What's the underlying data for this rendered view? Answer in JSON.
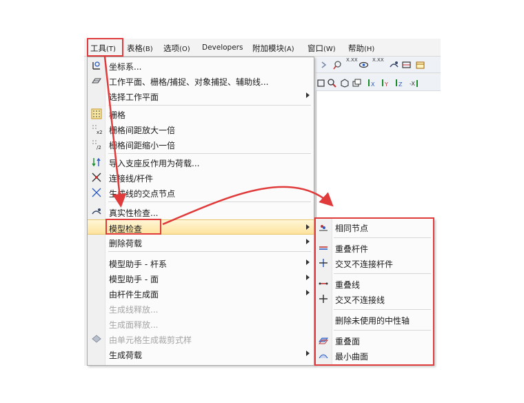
{
  "menubar": {
    "items": [
      {
        "label": "工具",
        "accel": "(T)"
      },
      {
        "label": "表格",
        "accel": "(B)"
      },
      {
        "label": "选项",
        "accel": "(O)"
      },
      {
        "label": "Developers",
        "accel": ""
      },
      {
        "label": "附加模块",
        "accel": "(A)"
      },
      {
        "label": "窗口",
        "accel": "(W)"
      },
      {
        "label": "帮助",
        "accel": "(H)"
      }
    ]
  },
  "toolbar": {
    "xxx_label": "X.XX"
  },
  "tools_menu": {
    "items": [
      {
        "label": "坐标系...",
        "icon": "coordinate-system-icon"
      },
      {
        "label": "工作平面、栅格/捕捉、对象捕捉、辅助线...",
        "icon": "work-plane-icon"
      },
      {
        "label": "选择工作平面",
        "icon": "",
        "submenu": true
      },
      {
        "label": "栅格",
        "icon": "grid-icon"
      },
      {
        "label": "栅格间距放大一倍",
        "icon": "grid-double-icon"
      },
      {
        "label": "栅格间距缩小一倍",
        "icon": "grid-half-icon"
      },
      {
        "label": "导入支座反作用为荷载...",
        "icon": "import-reactions-icon"
      },
      {
        "label": "连接线/杆件",
        "icon": "connect-lines-icon"
      },
      {
        "label": "生成线的交点节点",
        "icon": "intersection-nodes-icon"
      },
      {
        "label": "真实性检查...",
        "icon": "plausibility-check-icon"
      },
      {
        "label": "模型检查",
        "icon": "",
        "submenu": true,
        "highlighted": true
      },
      {
        "label": "删除荷载",
        "icon": "",
        "submenu": true
      },
      {
        "label": "模型助手 - 杆系",
        "icon": "",
        "submenu": true
      },
      {
        "label": "模型助手 - 面",
        "icon": "",
        "submenu": true
      },
      {
        "label": "由杆件生成面",
        "icon": "",
        "submenu": true
      },
      {
        "label": "生成线释放...",
        "icon": "",
        "disabled": true
      },
      {
        "label": "生成面释放...",
        "icon": "",
        "disabled": true
      },
      {
        "label": "由单元格生成裁剪式样",
        "icon": "clipping-pattern-icon",
        "disabled": true
      },
      {
        "label": "生成荷载",
        "icon": "",
        "submenu": true
      }
    ]
  },
  "model_check_submenu": {
    "items": [
      {
        "label": "相同节点",
        "icon": "identical-nodes-icon"
      },
      {
        "label": "重叠杆件",
        "icon": "overlapping-members-icon"
      },
      {
        "label": "交叉不连接杆件",
        "icon": "crossing-members-icon"
      },
      {
        "label": "重叠线",
        "icon": "overlapping-lines-icon"
      },
      {
        "label": "交叉不连接线",
        "icon": "crossing-lines-icon"
      },
      {
        "label": "删除未使用的中性轴",
        "icon": ""
      },
      {
        "label": "重叠面",
        "icon": "overlapping-surfaces-icon"
      },
      {
        "label": "最小曲面",
        "icon": "minimal-surface-icon"
      }
    ]
  },
  "colors": {
    "annotation_red": "#e03a3a",
    "highlight_top": "#fff6d7",
    "highlight_bottom": "#fde39d"
  }
}
